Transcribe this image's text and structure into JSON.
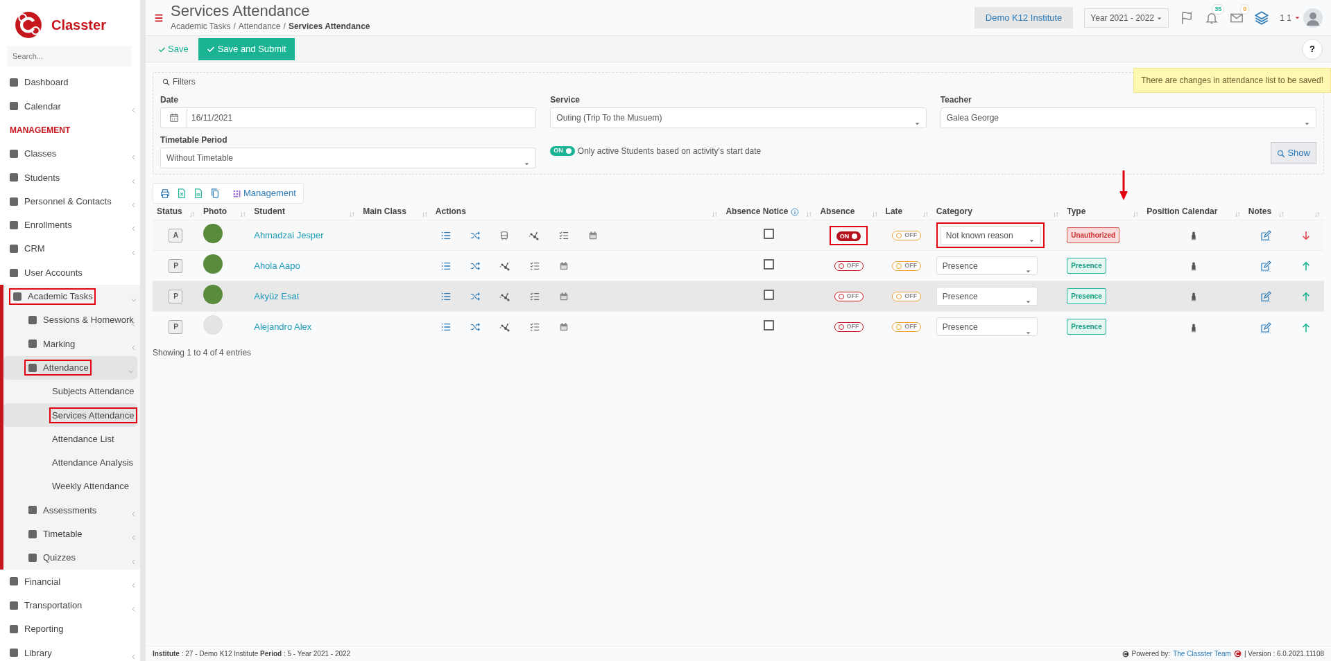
{
  "sidebar": {
    "logo_text": "Classter",
    "search_placeholder": "Search...",
    "items": [
      {
        "kind": "item",
        "label": "Dashboard",
        "selected": false,
        "annotated": false
      },
      {
        "kind": "item",
        "label": "Calendar",
        "expanded": false,
        "selected": false,
        "annotated": false
      },
      {
        "kind": "header",
        "label": "MANAGEMENT"
      },
      {
        "kind": "item",
        "label": "Classes",
        "expanded": false,
        "selected": false,
        "annotated": false
      },
      {
        "kind": "item",
        "label": "Students",
        "expanded": false,
        "selected": false,
        "annotated": false
      },
      {
        "kind": "item",
        "label": "Personnel & Contacts",
        "expanded": false,
        "selected": false,
        "annotated": false
      },
      {
        "kind": "item",
        "label": "Enrollments",
        "expanded": false,
        "selected": false,
        "annotated": false
      },
      {
        "kind": "item",
        "label": "CRM",
        "expanded": false,
        "selected": false,
        "annotated": false
      },
      {
        "kind": "item",
        "label": "User Accounts",
        "selected": false,
        "annotated": false
      },
      {
        "kind": "item",
        "label": "Academic Tasks",
        "expanded": true,
        "selected": false,
        "annotated": true,
        "children": [
          {
            "kind": "item",
            "label": "Sessions & Homework",
            "expanded": false,
            "selected": false,
            "annotated": false
          },
          {
            "kind": "item",
            "label": "Marking",
            "expanded": false,
            "selected": false,
            "annotated": false
          },
          {
            "kind": "item",
            "label": "Attendance",
            "expanded": true,
            "selected": true,
            "annotated": true,
            "children": [
              {
                "kind": "leaf",
                "label": "Subjects Attendance",
                "selected": false,
                "annotated": false
              },
              {
                "kind": "leaf",
                "label": "Services Attendance",
                "selected": true,
                "annotated": true
              },
              {
                "kind": "leaf",
                "label": "Attendance List",
                "selected": false,
                "annotated": false
              },
              {
                "kind": "leaf",
                "label": "Attendance Analysis",
                "selected": false,
                "annotated": false
              },
              {
                "kind": "leaf",
                "label": "Weekly Attendance",
                "selected": false,
                "annotated": false
              }
            ]
          },
          {
            "kind": "item",
            "label": "Assessments",
            "expanded": false,
            "selected": false,
            "annotated": false
          },
          {
            "kind": "item",
            "label": "Timetable",
            "expanded": false,
            "selected": false,
            "annotated": false
          },
          {
            "kind": "item",
            "label": "Quizzes",
            "expanded": false,
            "selected": false,
            "annotated": false
          }
        ]
      },
      {
        "kind": "item",
        "label": "Financial",
        "expanded": false,
        "selected": false,
        "annotated": false
      },
      {
        "kind": "item",
        "label": "Transportation",
        "expanded": false,
        "selected": false,
        "annotated": false
      },
      {
        "kind": "item",
        "label": "Reporting",
        "selected": false,
        "annotated": false
      },
      {
        "kind": "item",
        "label": "Library",
        "expanded": false,
        "selected": false,
        "annotated": false
      }
    ]
  },
  "header": {
    "title": "Services Attendance",
    "breadcrumb": [
      {
        "label": "Academic Tasks",
        "separator": "/"
      },
      {
        "label": "Attendance",
        "separator": "/"
      },
      {
        "label": "Services Attendance"
      }
    ],
    "institute": "Demo K12 Institute",
    "year": "Year 2021 - 2022",
    "notifications": "35",
    "messages": "0",
    "user": "1 1"
  },
  "toolbar": {
    "save": "Save",
    "save_submit": "Save and Submit",
    "help": "?"
  },
  "alert": "There are changes in attendance list to be saved!",
  "filters": {
    "legend": "Filters",
    "date_label": "Date",
    "date": "16/11/2021",
    "service_label": "Service",
    "service": "Outing (Trip To the Musuem)",
    "teacher_label": "Teacher",
    "teacher": "Galea George",
    "period_label": "Timetable Period",
    "period": "Without Timetable",
    "active_toggle": "ON",
    "active_on": true,
    "active_text": "Only active Students based on activity's start date",
    "show": "Show"
  },
  "table": {
    "management": "Management",
    "columns": [
      "Status",
      "Photo",
      "Student",
      "Main Class",
      "Actions",
      "Absence Notice",
      "Absence",
      "Late",
      "Category",
      "Type",
      "Position Calendar",
      "Notes"
    ],
    "rows": [
      {
        "status": "A",
        "photo": true,
        "student": "Ahmadzai Jesper",
        "transport": true,
        "notice": false,
        "absence": "ON",
        "absent": true,
        "late": "OFF",
        "is_late": false,
        "category": "Not known reason",
        "type": "Unauthorized",
        "authorized": false,
        "arrow_up": false,
        "highlighted": false,
        "annotated": true
      },
      {
        "status": "P",
        "photo": true,
        "student": "Ahola Aapo",
        "transport": false,
        "notice": false,
        "absence": "OFF",
        "absent": false,
        "late": "OFF",
        "is_late": false,
        "category": "Presence",
        "type": "Presence",
        "authorized": true,
        "arrow_up": true,
        "highlighted": false,
        "annotated": false
      },
      {
        "status": "P",
        "photo": true,
        "student": "Akyüz Esat",
        "transport": false,
        "notice": false,
        "absence": "OFF",
        "absent": false,
        "late": "OFF",
        "is_late": false,
        "category": "Presence",
        "type": "Presence",
        "authorized": true,
        "arrow_up": true,
        "highlighted": true,
        "annotated": false
      },
      {
        "status": "P",
        "photo": false,
        "student": "Alejandro Alex",
        "transport": false,
        "notice": false,
        "absence": "OFF",
        "absent": false,
        "late": "OFF",
        "is_late": false,
        "category": "Presence",
        "type": "Presence",
        "authorized": true,
        "arrow_up": true,
        "highlighted": false,
        "annotated": false
      }
    ],
    "info": "Showing 1 to 4 of 4 entries"
  },
  "footer": {
    "left": "**Institute** : 27 - Demo K12 Institute **Period** : 5 - Year 2021 - 2022",
    "powered": "Powered by:",
    "team": "The Classter Team",
    "version": "| Version : 6.0.2021.11108"
  }
}
